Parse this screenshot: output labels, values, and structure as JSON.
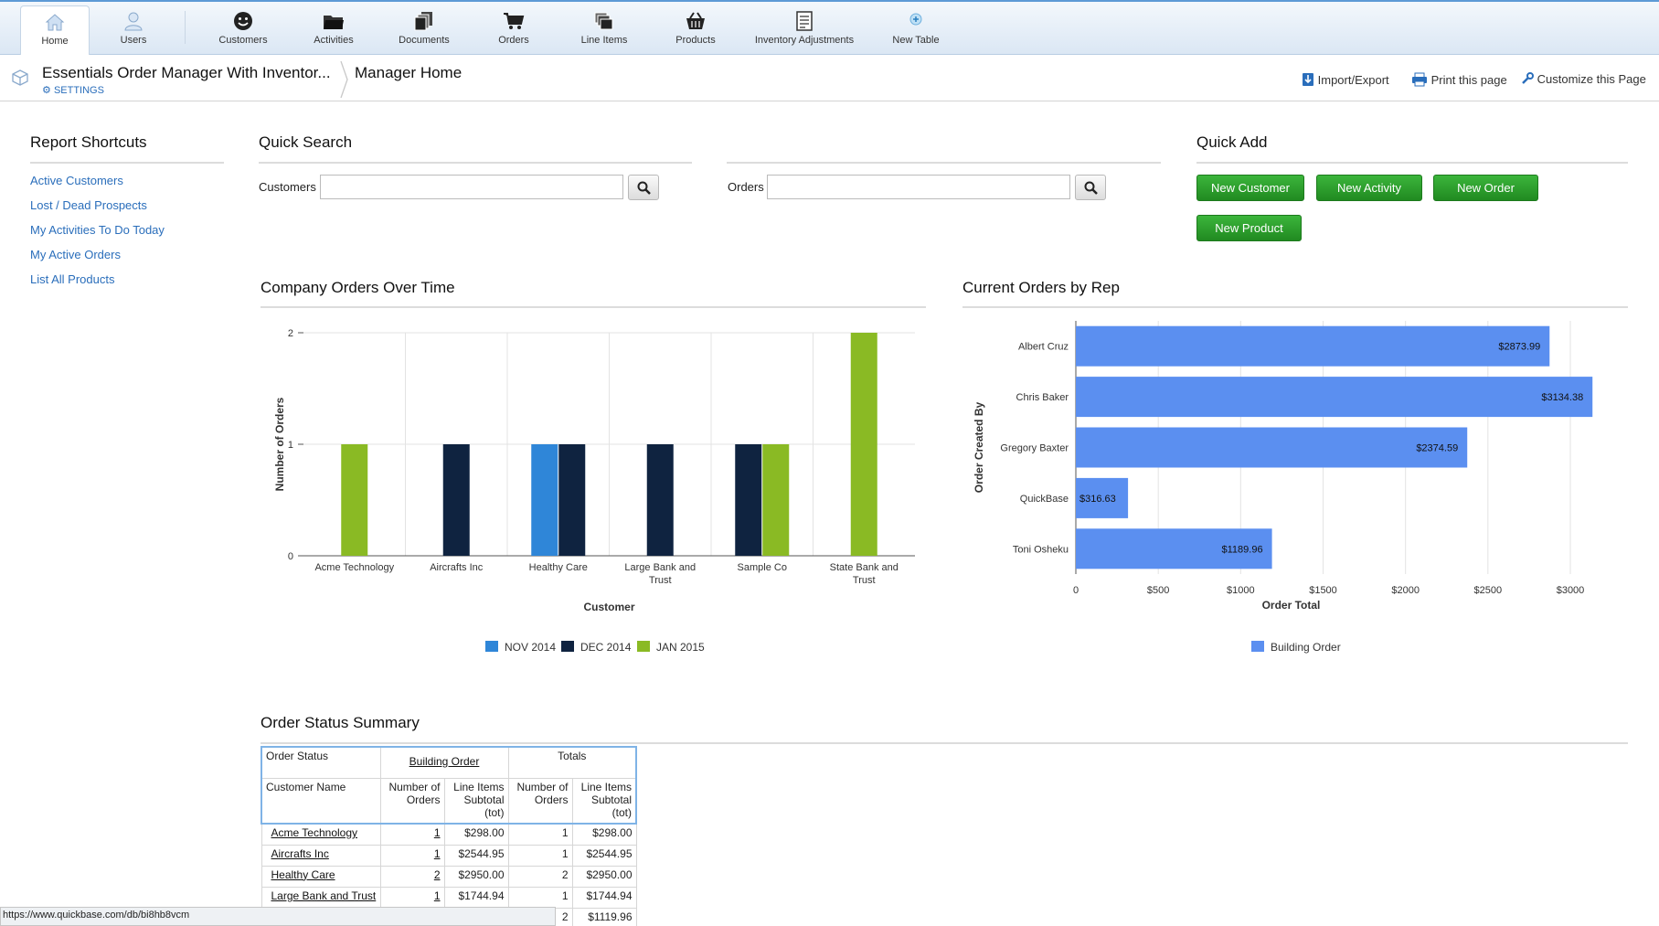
{
  "nav": {
    "items": [
      {
        "label": "Home",
        "icon": "home-icon"
      },
      {
        "label": "Users",
        "icon": "user-icon"
      },
      {
        "label": "Customers",
        "icon": "smiley-icon"
      },
      {
        "label": "Activities",
        "icon": "folder-icon"
      },
      {
        "label": "Documents",
        "icon": "documents-icon"
      },
      {
        "label": "Orders",
        "icon": "cart-icon"
      },
      {
        "label": "Line Items",
        "icon": "stack-icon"
      },
      {
        "label": "Products",
        "icon": "basket-icon"
      },
      {
        "label": "Inventory Adjustments",
        "icon": "clipboard-icon"
      },
      {
        "label": "New Table",
        "icon": "plus-circle-icon"
      }
    ]
  },
  "header": {
    "app_title": "Essentials Order Manager With Inventor...",
    "settings": "SETTINGS",
    "page_title": "Manager Home",
    "import_export": "Import/Export",
    "print": "Print this page",
    "customize": "Customize this Page"
  },
  "shortcuts": {
    "title": "Report Shortcuts",
    "items": [
      "Active Customers",
      "Lost / Dead Prospects",
      "My Activities To Do Today",
      "My Active Orders",
      "List All Products"
    ]
  },
  "quick_search": {
    "title": "Quick Search",
    "customers_label": "Customers",
    "customers_value": "",
    "orders_label": "Orders",
    "orders_value": ""
  },
  "quick_add": {
    "title": "Quick Add",
    "buttons": [
      "New Customer",
      "New Activity",
      "New Order",
      "New Product"
    ]
  },
  "chart_data": [
    {
      "type": "bar",
      "title": "Company Orders Over Time",
      "xlabel": "Customer",
      "ylabel": "Number of Orders",
      "ylim": [
        0,
        2
      ],
      "yticks": [
        "0",
        "1",
        "2"
      ],
      "categories": [
        "Acme Technology",
        "Aircrafts Inc",
        "Healthy Care",
        "Large Bank and Trust",
        "Sample Co",
        "State Bank and Trust"
      ],
      "series": [
        {
          "name": "NOV 2014",
          "color": "#2f86d8",
          "values": [
            0,
            0,
            1,
            0,
            0,
            0
          ]
        },
        {
          "name": "DEC 2014",
          "color": "#0f2340",
          "values": [
            0,
            1,
            1,
            1,
            1,
            0
          ]
        },
        {
          "name": "JAN 2015",
          "color": "#8aba24",
          "values": [
            1,
            0,
            0,
            0,
            1,
            2
          ]
        }
      ],
      "legend": "bottom",
      "grid": true
    },
    {
      "type": "bar",
      "orientation": "horizontal",
      "title": "Current Orders by Rep",
      "xlabel": "Order Total",
      "ylabel": "Order Created By",
      "xlim": [
        0,
        3000
      ],
      "xticks": [
        "0",
        "$500",
        "$1000",
        "$1500",
        "$2000",
        "$2500",
        "$3000"
      ],
      "categories": [
        "Albert Cruz",
        "Chris Baker",
        "Gregory Baxter",
        "QuickBase",
        "Toni Osheku"
      ],
      "series": [
        {
          "name": "Building Order",
          "color": "#5b8ff0",
          "values": [
            2873.99,
            3134.38,
            2374.59,
            316.63,
            1189.96
          ],
          "labels": [
            "$2873.99",
            "$3134.38",
            "$2374.59",
            "$316.63",
            "$1189.96"
          ]
        }
      ],
      "legend": "bottom",
      "grid": true
    }
  ],
  "summary": {
    "title": "Order Status Summary",
    "h_status": "Order Status",
    "h_group": "Building Order",
    "h_totals": "Totals",
    "h_customer": "Customer Name",
    "h_num": "Number of Orders",
    "h_sub": "Line Items Subtotal (tot)",
    "rows": [
      {
        "name": "Acme Technology",
        "num": "1",
        "sub": "$298.00",
        "tnum": "1",
        "tsub": "$298.00"
      },
      {
        "name": "Aircrafts Inc",
        "num": "1",
        "sub": "$2544.95",
        "tnum": "1",
        "tsub": "$2544.95"
      },
      {
        "name": "Healthy Care",
        "num": "2",
        "sub": "$2950.00",
        "tnum": "2",
        "tsub": "$2950.00"
      },
      {
        "name": "Large Bank and Trust",
        "num": "1",
        "sub": "$1744.94",
        "tnum": "1",
        "tsub": "$1744.94"
      }
    ],
    "partial_row": {
      "tnum": "2",
      "tsub": "$1119.96"
    }
  },
  "statusbar": "https://www.quickbase.com/db/bi8hb8vcm"
}
